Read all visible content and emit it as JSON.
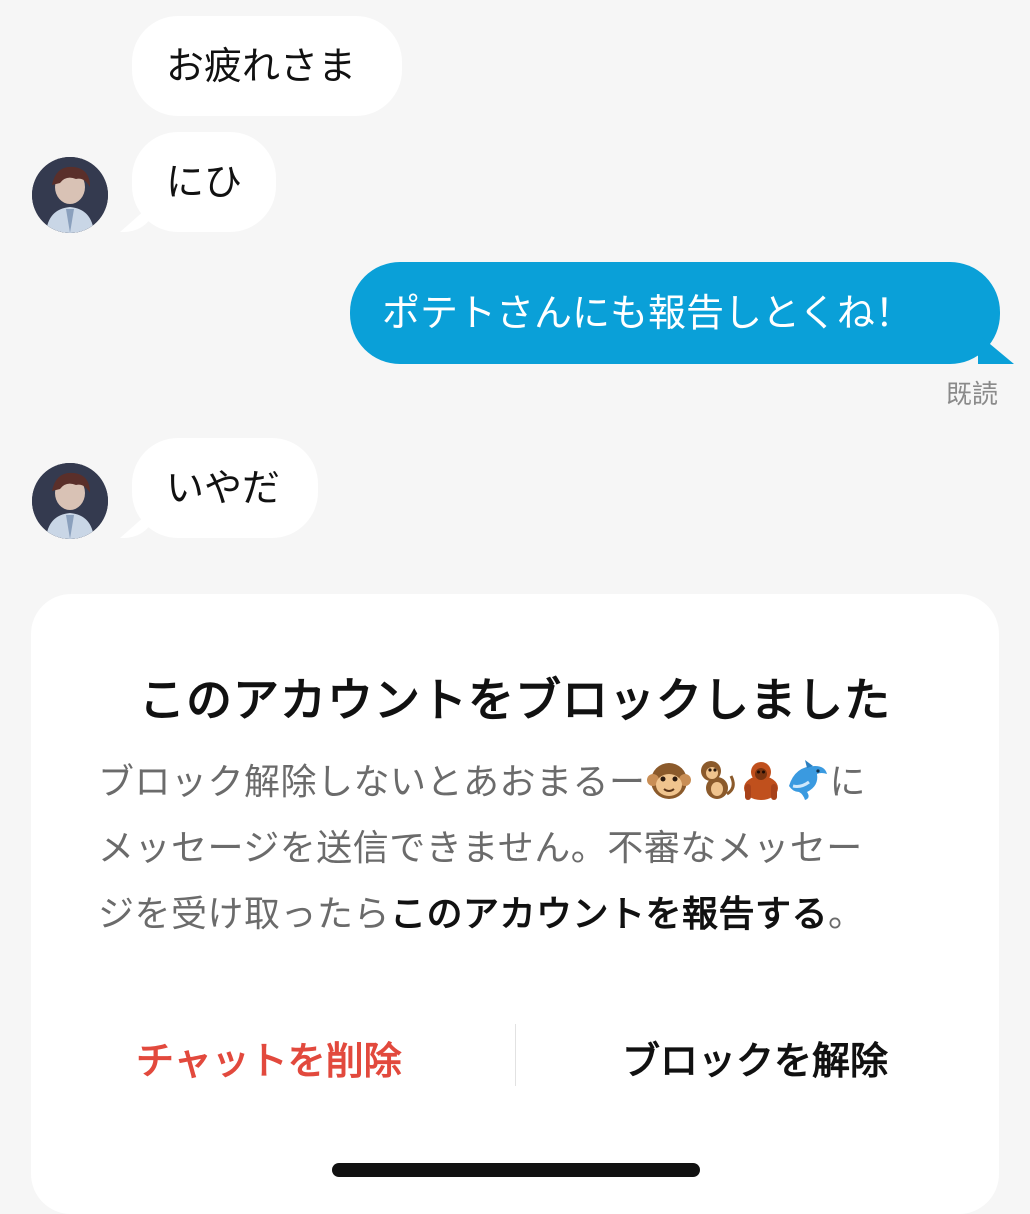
{
  "messages": [
    {
      "from": "other",
      "text": "お疲れさま"
    },
    {
      "from": "other",
      "text": "にひ"
    },
    {
      "from": "me",
      "text": "ポテトさんにも報告しとくね！",
      "status": "既読"
    },
    {
      "from": "other",
      "text": "いやだ"
    }
  ],
  "block_notice": {
    "title": "このアカウントをブロックしました",
    "body_line1_prefix": "ブロック解除しないとあおまるー",
    "body_line1_suffix": "に",
    "body_line2": "メッセージを送信できません。不審なメッセー",
    "body_line3_prefix": "ジを受け取ったら",
    "body_line3_link": "このアカウントを報告する",
    "body_line3_suffix": "。",
    "emojis": [
      "monkey-face",
      "monkey",
      "orangutan",
      "dolphin"
    ]
  },
  "actions": {
    "delete_chat": "チャットを削除",
    "unblock": "ブロックを解除"
  },
  "colors": {
    "background": "#f6f6f6",
    "outgoing_bubble": "#0aa0d8",
    "incoming_bubble": "#ffffff",
    "destructive": "#e2493d"
  }
}
